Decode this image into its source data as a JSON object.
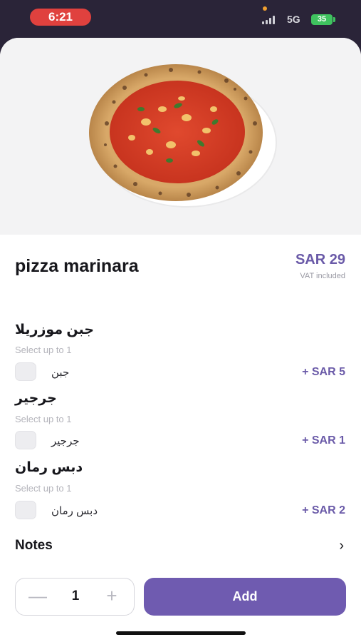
{
  "status_bar": {
    "time": "6:21",
    "network": "5G",
    "battery": "35"
  },
  "product": {
    "name": "pizza marinara",
    "price": "SAR 29",
    "vat_note": "VAT included",
    "image_icon": "pizza-photo"
  },
  "option_groups": [
    {
      "title": "جبن موزريلا",
      "subtitle": "Select up to 1",
      "option": {
        "label": "جبن",
        "price": "+ SAR 5",
        "checked": false
      }
    },
    {
      "title": "جرجير",
      "subtitle": "Select up to 1",
      "option": {
        "label": "جرجير",
        "price": "+ SAR 1",
        "checked": false
      }
    },
    {
      "title": "دبس رمان",
      "subtitle": "Select up to 1",
      "option": {
        "label": "دبس رمان",
        "price": "+ SAR 2",
        "checked": false
      }
    }
  ],
  "notes": {
    "label": "Notes",
    "chevron": "›"
  },
  "cart": {
    "quantity": "1",
    "minus": "—",
    "plus": "+",
    "add_label": "Add"
  },
  "colors": {
    "accent": "#6f5bb0",
    "price": "#6a5aa8",
    "status_pill": "#e0413e",
    "header_bg": "#2a2438"
  }
}
